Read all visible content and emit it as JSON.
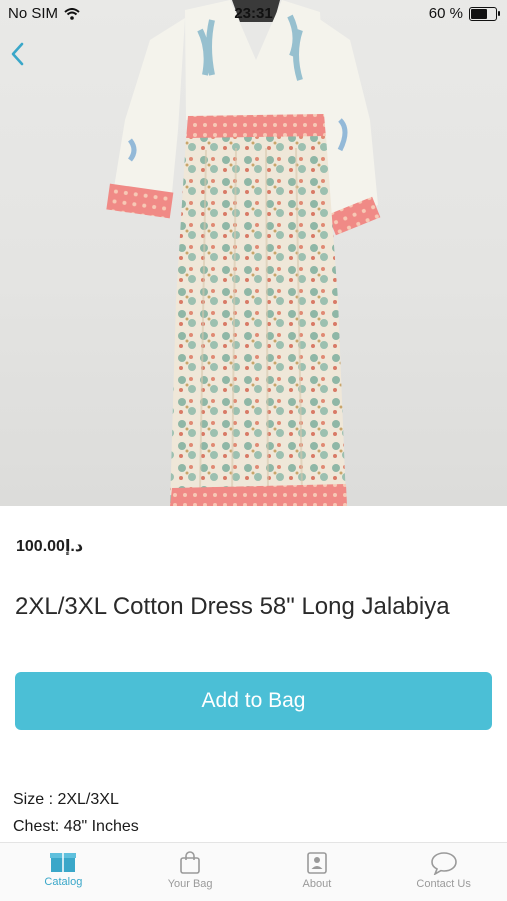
{
  "status_bar": {
    "carrier": "No SIM",
    "time": "23:31",
    "battery_text": "60 %",
    "battery_level": 0.6
  },
  "product": {
    "price": "د.إ100.00",
    "title": "2XL/3XL Cotton Dress 58\" Long Jalabiya",
    "add_to_bag_label": "Add to Bag",
    "details": [
      "Size : 2XL/3XL",
      "Chest: 48\" Inches"
    ]
  },
  "tab_bar": {
    "items": [
      {
        "label": "Catalog",
        "icon": "catalog-box-icon",
        "active": true
      },
      {
        "label": "Your Bag",
        "icon": "shopping-bag-icon",
        "active": false
      },
      {
        "label": "About",
        "icon": "person-card-icon",
        "active": false
      },
      {
        "label": "Contact Us",
        "icon": "chat-bubble-icon",
        "active": false
      }
    ]
  },
  "colors": {
    "accent": "#4bbfd6",
    "tab_active": "#3aa7c9",
    "tab_inactive": "#9a9a9a"
  }
}
